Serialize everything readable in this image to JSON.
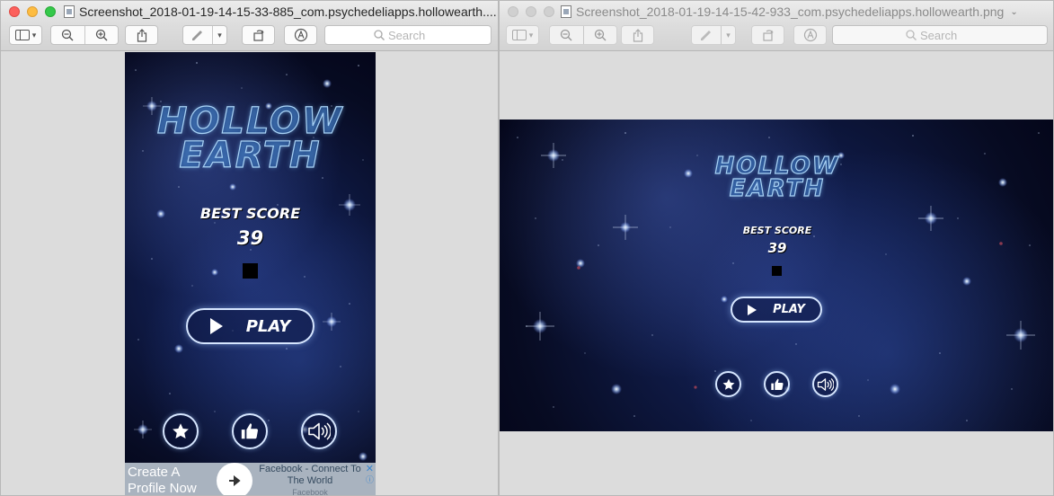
{
  "windows": [
    {
      "title": "Screenshot_2018-01-19-14-15-33-885_com.psychedeliapps.hollowearth....",
      "active": true,
      "search_placeholder": "Search"
    },
    {
      "title": "Screenshot_2018-01-19-14-15-42-933_com.psychedeliapps.hollowearth.png",
      "active": false,
      "search_placeholder": "Search"
    }
  ],
  "game": {
    "logo_line1": "HOLLOW",
    "logo_line2": "EARTH",
    "best_score_label": "BEST SCORE",
    "best_score_value": "39",
    "play_label": "PLAY"
  },
  "ad": {
    "left_text_line1": "Create A",
    "left_text_line2": "Profile Now",
    "right_text": "Facebook - Connect To The World",
    "sponsor": "Facebook",
    "close": "✕",
    "info": "ⓘ"
  },
  "icons": [
    "sidebar-icon",
    "zoom-out-icon",
    "zoom-in-icon",
    "share-icon",
    "markup-pen-icon",
    "rotate-icon",
    "annotate-icon",
    "search-icon",
    "star-icon",
    "thumbs-up-icon",
    "speaker-icon",
    "arrow-right-icon"
  ],
  "colors": {
    "button_border": "#d6e6ff",
    "logo_stroke": "#a8d2f5",
    "ad_bg": "#a9b3bf"
  }
}
